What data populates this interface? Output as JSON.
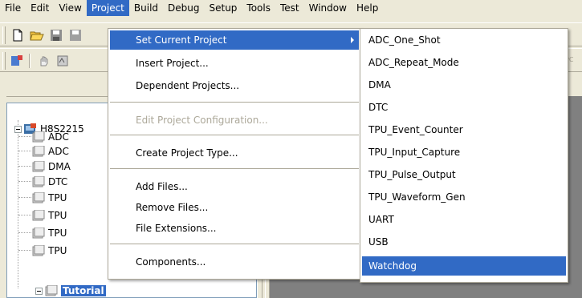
{
  "menubar": {
    "items": [
      "File",
      "Edit",
      "View",
      "Project",
      "Build",
      "Debug",
      "Setup",
      "Tools",
      "Test",
      "Window",
      "Help"
    ],
    "active": "Project"
  },
  "project_menu": {
    "set_current_project": "Set Current Project",
    "insert_project": "Insert Project...",
    "dependent_projects": "Dependent Projects...",
    "edit_project_configuration": "Edit Project Configuration...",
    "create_project_type": "Create Project Type...",
    "add_files": "Add Files...",
    "remove_files": "Remove Files...",
    "file_extensions": "File Extensions...",
    "components": "Components..."
  },
  "submenu": {
    "items": [
      "ADC_One_Shot",
      "ADC_Repeat_Mode",
      "DMA",
      "DTC",
      "TPU_Event_Counter",
      "TPU_Input_Capture",
      "TPU_Pulse_Output",
      "TPU_Waveform_Gen",
      "UART",
      "USB",
      "Watchdog"
    ],
    "highlighted": "Watchdog"
  },
  "workspace": {
    "root_label": "H8S2215",
    "children": [
      "ADC",
      "ADC",
      "DMA",
      "DTC",
      "TPU",
      "TPU",
      "TPU",
      "TPU"
    ],
    "tutorial_label": "Tutorial"
  },
  "toolbar_fragment": "PC",
  "colors": {
    "highlight": "#316ac5",
    "chrome": "#ece9d8",
    "mdi_background": "#808080"
  }
}
